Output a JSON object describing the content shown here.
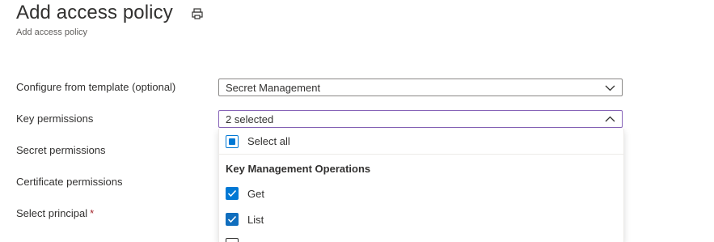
{
  "header": {
    "title": "Add access policy",
    "subtitle": "Add access policy",
    "print_icon": "print-icon"
  },
  "form": {
    "template": {
      "label": "Configure from template (optional)",
      "value": "Secret Management"
    },
    "key_permissions": {
      "label": "Key permissions",
      "value": "2 selected"
    },
    "secret_permissions": {
      "label": "Secret permissions"
    },
    "certificate_permissions": {
      "label": "Certificate permissions"
    },
    "principal": {
      "label": "Select principal",
      "required_mark": "*"
    }
  },
  "key_permissions_menu": {
    "select_all": {
      "label": "Select all",
      "state": "indeterminate"
    },
    "group_header": "Key Management Operations",
    "options": [
      {
        "label": "Get",
        "checked": true
      },
      {
        "label": "List",
        "checked": true
      }
    ]
  },
  "colors": {
    "accent": "#0078d4",
    "focus_border": "#8764b8",
    "required": "#a4262c"
  }
}
